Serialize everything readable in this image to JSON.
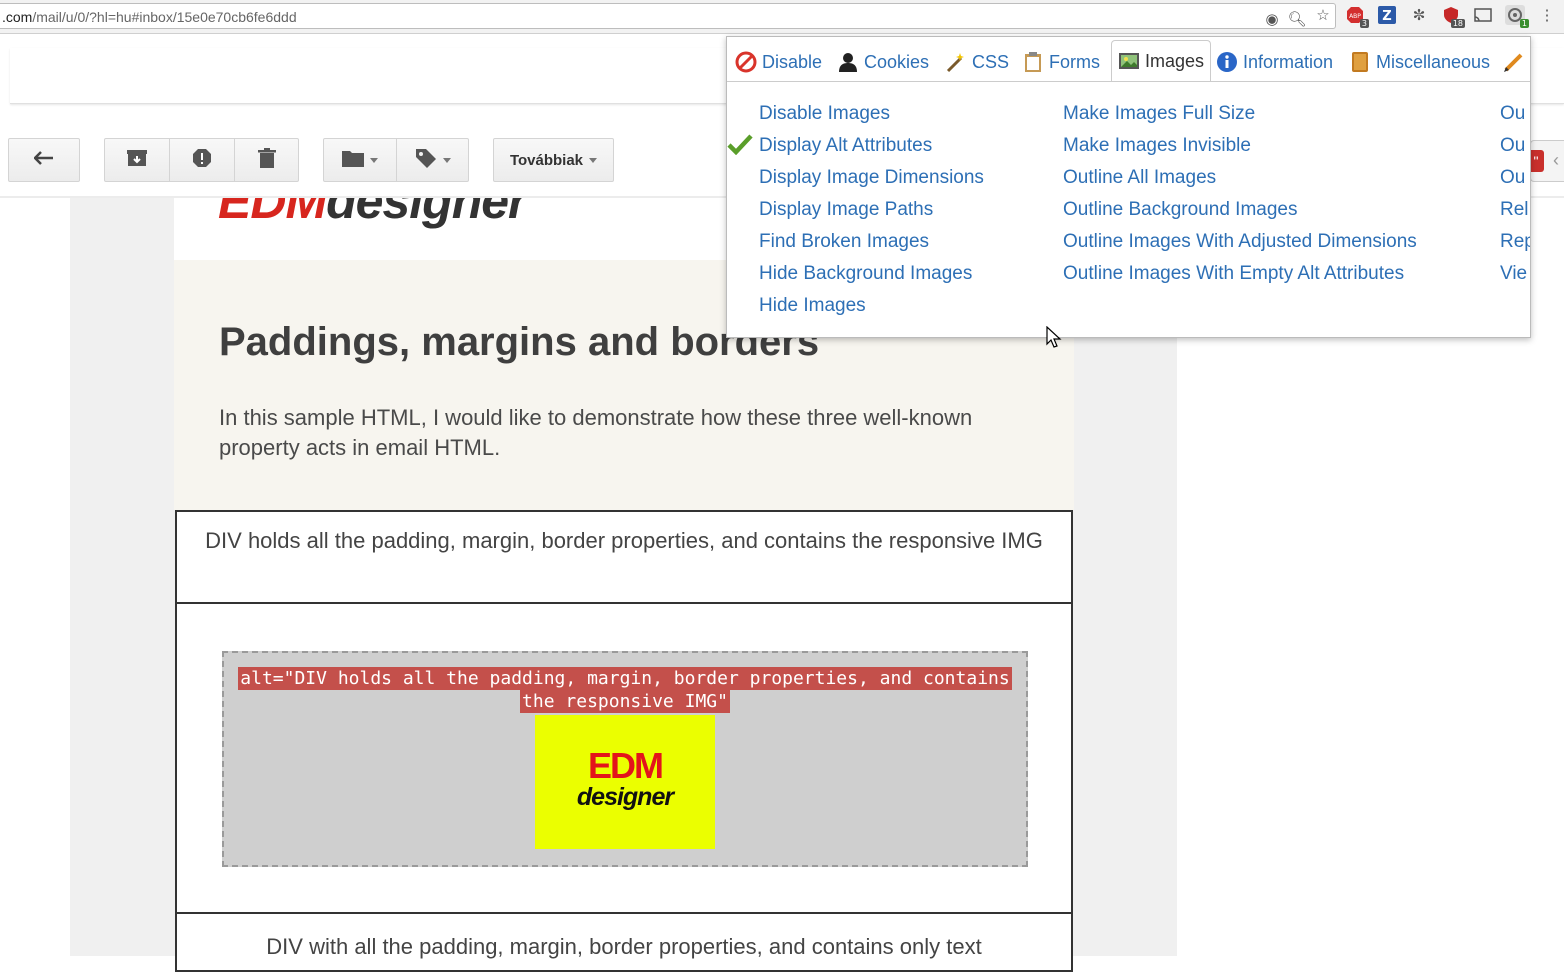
{
  "browser": {
    "url_host": ".com",
    "url_path": "/mail/u/0/?hl=hu#inbox/15e0e70cb6fe6ddd",
    "extensions": [
      {
        "name": "eye-icon",
        "badge": ""
      },
      {
        "name": "zoom-icon",
        "badge": ""
      },
      {
        "name": "star-icon",
        "badge": ""
      },
      {
        "name": "adblock-icon",
        "badge": "3"
      },
      {
        "name": "zotero-icon",
        "badge": ""
      },
      {
        "name": "ghostery-icon",
        "badge": ""
      },
      {
        "name": "shield-icon",
        "badge": "18"
      },
      {
        "name": "cast-icon",
        "badge": ""
      },
      {
        "name": "web-developer-icon",
        "badge": "1"
      },
      {
        "name": "menu-icon",
        "badge": ""
      }
    ]
  },
  "gmail": {
    "toolbar": {
      "more_label": "Továbbiak"
    }
  },
  "email": {
    "title": "Paddings, margins and borders",
    "intro": "In this sample HTML, I would like to demonstrate how these three well-known property acts in email HTML.",
    "cell1": "DIV holds all the padding, margin, border properties, and contains the responsive IMG",
    "alt_text": "alt=\"DIV holds all the padding, margin, border properties, and contains the responsive IMG\"",
    "logo_top": "EDM",
    "logo_bottom": "designer",
    "cell3": "DIV with all the padding, margin, border properties, and contains only text"
  },
  "webdev": {
    "tabs": [
      {
        "label": "Disable",
        "icon": "disable-icon",
        "active": false
      },
      {
        "label": "Cookies",
        "icon": "cookies-icon",
        "active": false
      },
      {
        "label": "CSS",
        "icon": "css-icon",
        "active": false
      },
      {
        "label": "Forms",
        "icon": "forms-icon",
        "active": false
      },
      {
        "label": "Images",
        "icon": "images-icon",
        "active": true
      },
      {
        "label": "Information",
        "icon": "information-icon",
        "active": false
      },
      {
        "label": "Miscellaneous",
        "icon": "miscellaneous-icon",
        "active": false
      },
      {
        "label": "",
        "icon": "pencil-icon",
        "active": false
      }
    ],
    "column1": [
      {
        "label": "Disable Images",
        "checked": false
      },
      {
        "label": "Display Alt Attributes",
        "checked": true
      },
      {
        "label": "Display Image Dimensions",
        "checked": false
      },
      {
        "label": "Display Image Paths",
        "checked": false
      },
      {
        "label": "Find Broken Images",
        "checked": false
      },
      {
        "label": "Hide Background Images",
        "checked": false
      },
      {
        "label": "Hide Images",
        "checked": false
      }
    ],
    "column2": [
      "Make Images Full Size",
      "Make Images Invisible",
      "Outline All Images",
      "Outline Background Images",
      "Outline Images With Adjusted Dimensions",
      "Outline Images With Empty Alt Attributes"
    ],
    "column3": [
      "Ou",
      "Ou",
      "Ou",
      "Rel",
      "Rep",
      "Vie"
    ]
  },
  "colors": {
    "link": "#2d6fb5",
    "alt_bg": "#c4504b",
    "logo_bg": "#ebff00",
    "logo_red": "#e3141b",
    "hero_bg": "#f7f5ef"
  }
}
